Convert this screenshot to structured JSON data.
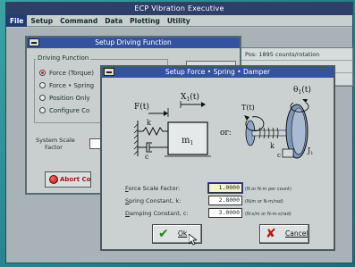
{
  "app": {
    "title": "ECP Vibration Executive",
    "menu": [
      "File",
      "Setup",
      "Command",
      "Data",
      "Plotting",
      "Utility"
    ]
  },
  "readouts": [
    "Pos:   1895  counts/rotation",
    "",
    ""
  ],
  "driving_function": {
    "title": "Setup Driving Function",
    "group_label": "Driving Function",
    "options": [
      "Force (Torque)",
      "Force • Spring",
      "Position Only",
      "Configure Co"
    ],
    "selected_index": 0,
    "scale_label_1": "System Scale",
    "scale_label_2": "Factor",
    "abort_label": "Abort Control"
  },
  "fsd": {
    "title": "Setup Force • Spring • Damper",
    "diagram": {
      "F": "F(t)",
      "x1": "X",
      "x1_sub": "1",
      "x1_arg": "(t)",
      "k": "k",
      "m": "m",
      "m_sub": "1",
      "c": "c",
      "or": "or:",
      "T": "T(t)",
      "theta": "θ",
      "theta_sub": "1",
      "theta_arg": "(t)",
      "k2": "k",
      "c2": "c",
      "J": "J",
      "J_sub": "1"
    },
    "fields": [
      {
        "pre": "F",
        "label": "orce Scale Factor:",
        "value": "1.0000",
        "unit": "(N or N-m per count)",
        "selected": true
      },
      {
        "pre": "S",
        "label": "pring Constant, k:",
        "value": "2.8000",
        "unit": "(N/m or N-m/rad)",
        "selected": false
      },
      {
        "pre": "D",
        "label": "amping Constant, c:",
        "value": "3.0000",
        "unit": "(N-s/m or N-m-s/rad)",
        "selected": false
      }
    ],
    "ok_label": "Ok",
    "cancel_label": "Cancel"
  },
  "colors": {
    "title_bar": "#3552a0",
    "desktop": "#24858f"
  }
}
